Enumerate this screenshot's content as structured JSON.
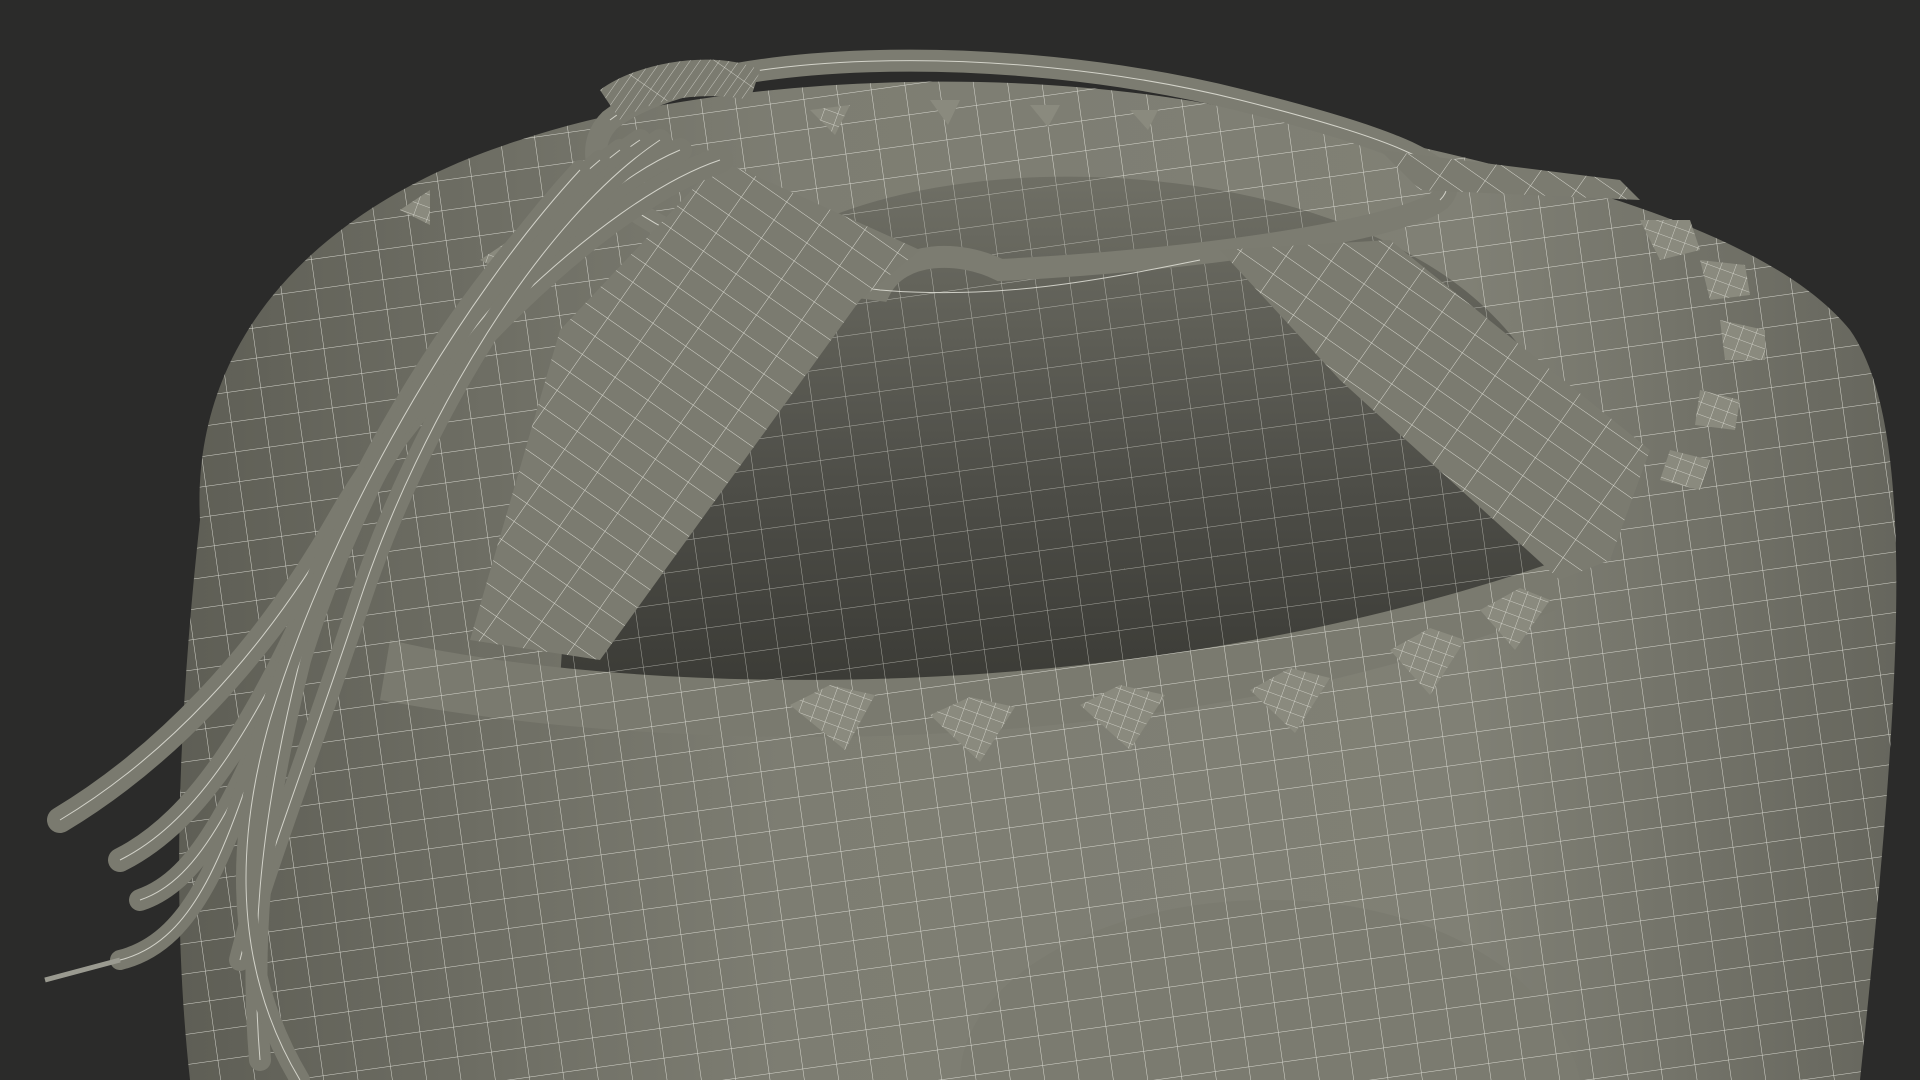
{
  "scene": {
    "background_color": "#2b2b2a",
    "mesh_fill_color": "#7b7b70",
    "mesh_shadow_color": "#4a4a44",
    "wire_color": "#e8e8e0",
    "subject": "wireframe-3d-model-boxing-glove-cuff-with-laces"
  }
}
